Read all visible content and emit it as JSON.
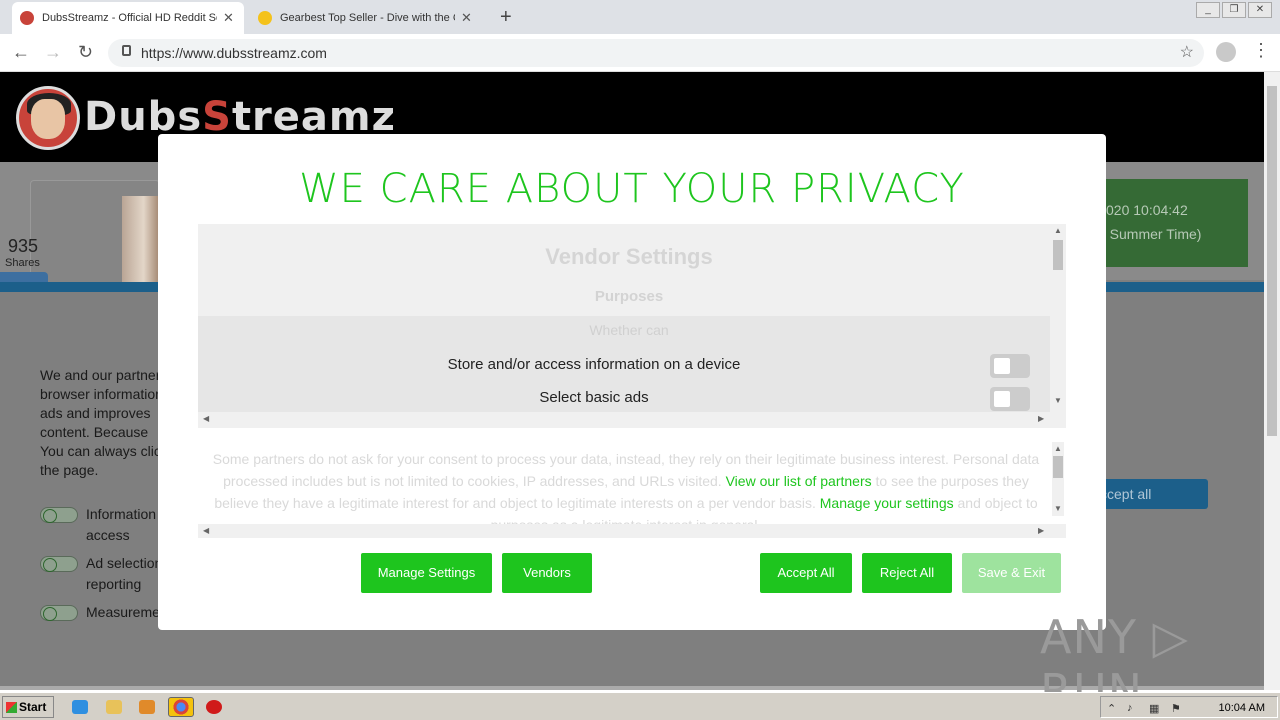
{
  "browser": {
    "tabs": [
      {
        "title": "DubsStreamz - Official HD Reddit So",
        "close": "✕"
      },
      {
        "title": "Gearbest Top Seller - Dive with the C",
        "close": "✕"
      }
    ],
    "new_tab": "+",
    "url": "https://www.dubsstreamz.com",
    "window_buttons": [
      "_",
      "❐",
      "✕"
    ]
  },
  "site": {
    "brand_prefix": "Dubs",
    "brand_accent": "S",
    "brand_suffix": "treamz",
    "shares_count": "935",
    "shares_label": "Shares",
    "clock_line1": "020 10:04:42",
    "clock_line2": "h Summer Time)",
    "consent_text": "We and our partners browser information ads and improves content. Because You can always click the page.",
    "options": [
      {
        "label_l1": "Information",
        "label_l2": "access"
      },
      {
        "label_l1": "Ad selection",
        "label_l2": "reporting"
      },
      {
        "label_l1": "Measurement",
        "label_l2": ""
      }
    ],
    "accept_all_bg": "ccept all"
  },
  "modal": {
    "title": "WE CARE ABOUT YOUR PRIVACY",
    "vendor_settings_title": "Vendor Settings",
    "purposes_label": "Purposes",
    "hidden_label": "Whether can",
    "purposes": [
      {
        "label": "Store and/or access information on a device",
        "enabled": false
      },
      {
        "label": "Select basic ads",
        "enabled": false
      }
    ],
    "legit_text_pre": "Some partners do not ask for your consent to process your data, instead, they rely on their legitimate business interest. Personal data processed includes but is not limited to cookies, IP addresses, and URLs visited.",
    "legit_link_partners": "View our list of partners",
    "legit_text_mid": "to see the purposes they believe they have a legitimate interest for and object to legitimate interests on a per vendor basis.",
    "legit_link_manage": "Manage your settings",
    "legit_text_post": "and object to purposes as a legitimate interest in general.",
    "buttons": {
      "manage_settings": "Manage Settings",
      "vendors": "Vendors",
      "accept_all": "Accept All",
      "reject_all": "Reject All",
      "save_exit": "Save & Exit"
    }
  },
  "watermark": "ANY ▷ RUN",
  "taskbar": {
    "start": "Start",
    "time": "10:04 AM"
  },
  "colors": {
    "accent": "#1ec51e",
    "accent_disabled": "#9ee39e"
  }
}
